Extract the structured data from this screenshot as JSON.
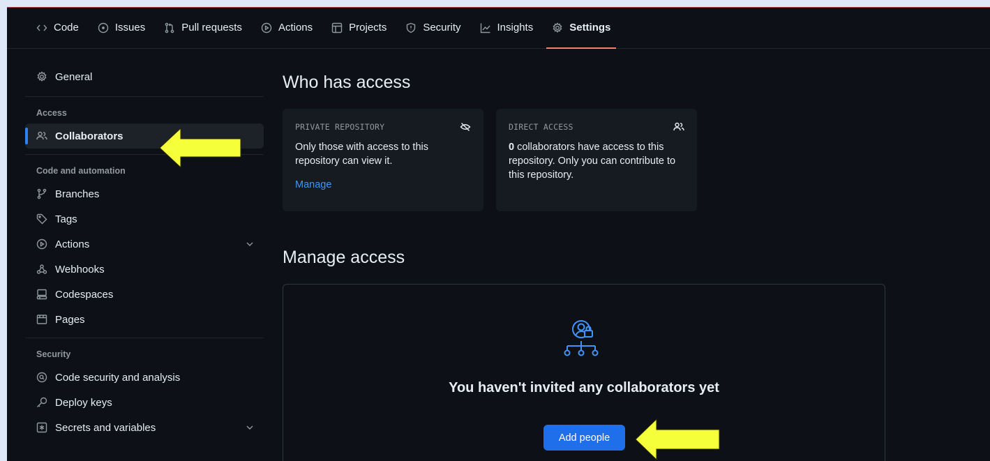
{
  "repo_nav": {
    "tabs": [
      {
        "label": "Code",
        "icon": "code-icon"
      },
      {
        "label": "Issues",
        "icon": "issue-icon"
      },
      {
        "label": "Pull requests",
        "icon": "pull-request-icon"
      },
      {
        "label": "Actions",
        "icon": "play-icon"
      },
      {
        "label": "Projects",
        "icon": "table-icon"
      },
      {
        "label": "Security",
        "icon": "shield-icon"
      },
      {
        "label": "Insights",
        "icon": "graph-icon"
      },
      {
        "label": "Settings",
        "icon": "gear-icon",
        "active": true
      }
    ]
  },
  "sidebar": {
    "general": "General",
    "groups": [
      {
        "title": "Access",
        "items": [
          {
            "label": "Collaborators",
            "icon": "people-icon",
            "active": true
          }
        ]
      },
      {
        "title": "Code and automation",
        "items": [
          {
            "label": "Branches",
            "icon": "branch-icon"
          },
          {
            "label": "Tags",
            "icon": "tag-icon"
          },
          {
            "label": "Actions",
            "icon": "play-icon",
            "expandable": true
          },
          {
            "label": "Webhooks",
            "icon": "webhook-icon"
          },
          {
            "label": "Codespaces",
            "icon": "codespaces-icon"
          },
          {
            "label": "Pages",
            "icon": "browser-icon"
          }
        ]
      },
      {
        "title": "Security",
        "items": [
          {
            "label": "Code security and analysis",
            "icon": "codescan-icon"
          },
          {
            "label": "Deploy keys",
            "icon": "key-icon"
          },
          {
            "label": "Secrets and variables",
            "icon": "asterisk-icon",
            "expandable": true
          }
        ]
      }
    ]
  },
  "who_has_access": {
    "heading": "Who has access",
    "private_card": {
      "label": "PRIVATE REPOSITORY",
      "text": "Only those with access to this repository can view it.",
      "link": "Manage"
    },
    "direct_card": {
      "label": "DIRECT ACCESS",
      "count": "0",
      "text": " collaborators have access to this repository. Only you can contribute to this repository."
    }
  },
  "manage_access": {
    "heading": "Manage access",
    "empty_title": "You haven't invited any collaborators yet",
    "add_button": "Add people"
  },
  "colors": {
    "background": "#0d1117",
    "accent_blue": "#1f6feb",
    "link_blue": "#4493f8",
    "active_tab_underline": "#f78166",
    "annotation_arrow": "#f5ff3a"
  }
}
